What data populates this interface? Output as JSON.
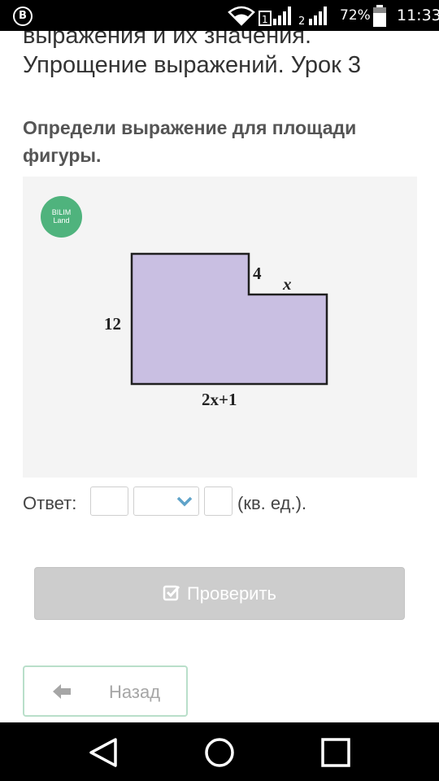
{
  "status_bar": {
    "app_badge": "B",
    "sim1_label": "1",
    "sim2_label": "2",
    "battery_percent": "72%",
    "time": "11:33"
  },
  "page": {
    "title_line1": "выражения и их значения.",
    "title_line2": "Упрощение выражений. Урок 3"
  },
  "question": {
    "text": "Определи выражение для площади фигуры."
  },
  "figure": {
    "logo_line1": "BILIM",
    "logo_line2": "Land",
    "label_height": "12",
    "label_notch": "4",
    "label_step": "x",
    "label_base": "2x+1",
    "fill_color": "#c9bfe2",
    "stroke_color": "#1f1f1f"
  },
  "answer": {
    "label": "Ответ:",
    "field1_value": "",
    "select_value": "",
    "field2_value": "",
    "units": "(кв. ед.)."
  },
  "actions": {
    "check_label": "Проверить",
    "back_label": "Назад"
  },
  "colors": {
    "accent": "#4fb37d",
    "button_disabled": "#cdcdcd",
    "back_border": "#b9dfca"
  }
}
